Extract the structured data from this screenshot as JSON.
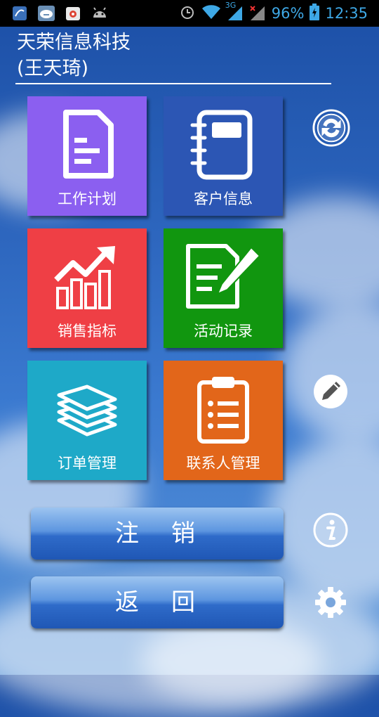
{
  "status_bar": {
    "network_type": "3G",
    "battery": "96%",
    "time": "12:35",
    "icons": [
      "app-notification-icon",
      "cloud-sync-icon",
      "store-icon",
      "android-icon",
      "alarm-icon",
      "wifi-icon",
      "signal-icon",
      "no-signal-icon",
      "battery-icon"
    ]
  },
  "header": {
    "company": "天荣信息科技",
    "user": "(王天琦)"
  },
  "tiles": [
    {
      "label": "工作计划",
      "color": "#8b5ff0",
      "icon": "document-icon"
    },
    {
      "label": "客户信息",
      "color": "#2c56b4",
      "icon": "notebook-icon"
    },
    {
      "label": "销售指标",
      "color": "#ef3f45",
      "icon": "chart-trend-icon"
    },
    {
      "label": "活动记录",
      "color": "#11960f",
      "icon": "edit-document-icon"
    },
    {
      "label": "订单管理",
      "color": "#1ea9c8",
      "icon": "stack-icon"
    },
    {
      "label": "联系人管理",
      "color": "#e2661a",
      "icon": "clipboard-icon"
    }
  ],
  "buttons": {
    "logout": "注　销",
    "back": "返　回"
  },
  "side_icons": [
    "sync-icon",
    "pencil-icon",
    "info-icon",
    "settings-icon"
  ]
}
